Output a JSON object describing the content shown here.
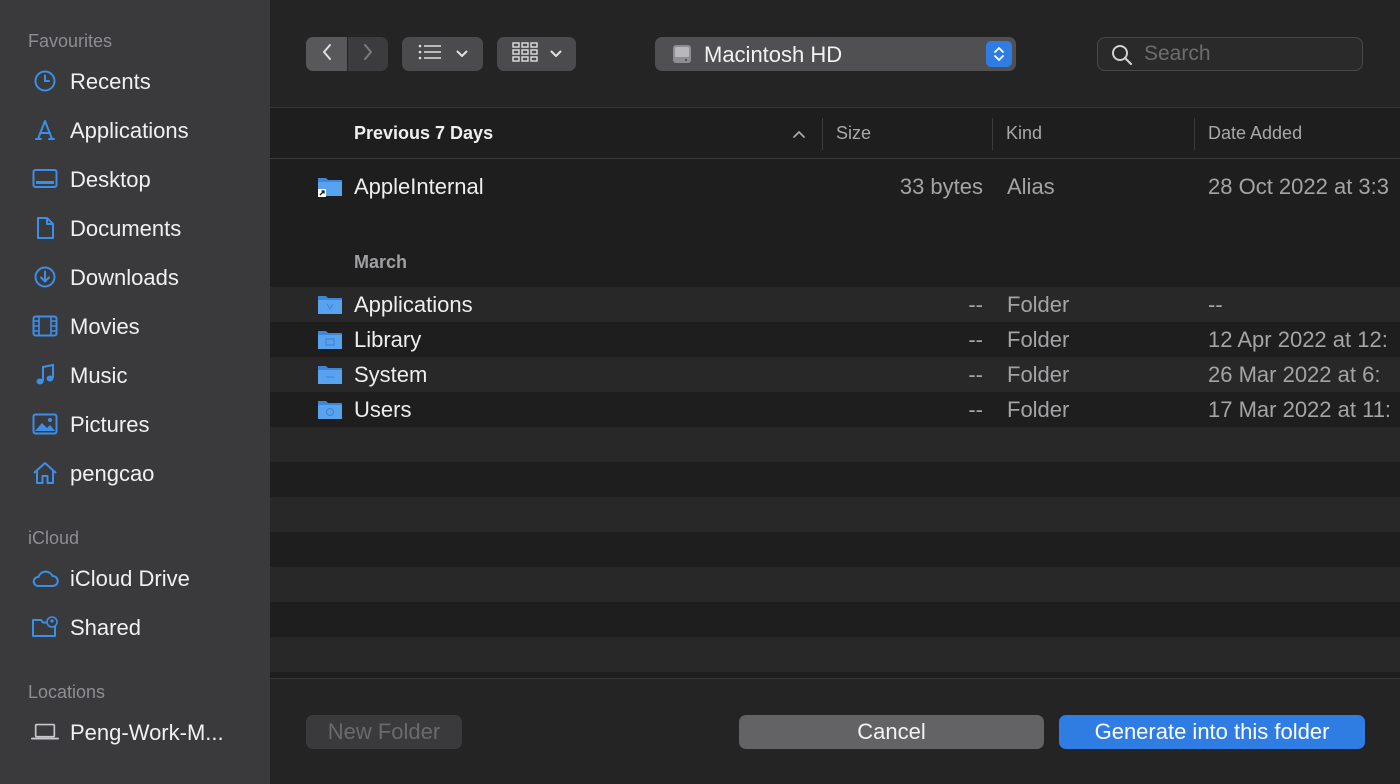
{
  "sidebar": {
    "favourites_header": "Favourites",
    "favourites": [
      {
        "label": "Recents",
        "icon": "clock-icon"
      },
      {
        "label": "Applications",
        "icon": "applications-icon"
      },
      {
        "label": "Desktop",
        "icon": "desktop-icon"
      },
      {
        "label": "Documents",
        "icon": "document-icon"
      },
      {
        "label": "Downloads",
        "icon": "download-icon"
      },
      {
        "label": "Movies",
        "icon": "film-icon"
      },
      {
        "label": "Music",
        "icon": "music-note-icon"
      },
      {
        "label": "Pictures",
        "icon": "photo-icon"
      },
      {
        "label": "pengcao",
        "icon": "home-icon"
      }
    ],
    "icloud_header": "iCloud",
    "icloud": [
      {
        "label": "iCloud Drive",
        "icon": "cloud-icon"
      },
      {
        "label": "Shared",
        "icon": "shared-folder-icon"
      }
    ],
    "locations_header": "Locations",
    "locations": [
      {
        "label": "Peng-Work-M...",
        "icon": "laptop-icon"
      }
    ]
  },
  "toolbar": {
    "location": "Macintosh HD",
    "search_placeholder": "Search"
  },
  "columns": {
    "name": "Previous 7 Days",
    "size": "Size",
    "kind": "Kind",
    "date": "Date Added"
  },
  "groups": [
    {
      "label": "",
      "rows": [
        {
          "name": "AppleInternal",
          "size": "33 bytes",
          "kind": "Alias",
          "date": "28 Oct 2022 at 3:3"
        }
      ]
    },
    {
      "label": "March",
      "rows": [
        {
          "name": "Applications",
          "size": "--",
          "kind": "Folder",
          "date": "--"
        },
        {
          "name": "Library",
          "size": "--",
          "kind": "Folder",
          "date": "12 Apr 2022 at 12:"
        },
        {
          "name": "System",
          "size": "--",
          "kind": "Folder",
          "date": "26 Mar 2022 at 6:"
        },
        {
          "name": "Users",
          "size": "--",
          "kind": "Folder",
          "date": "17 Mar 2022 at 11:"
        }
      ]
    }
  ],
  "buttons": {
    "new_folder": "New Folder",
    "cancel": "Cancel",
    "generate": "Generate into this folder"
  },
  "colors": {
    "accent": "#2f7de3",
    "sidebar_bg": "#3a3a3c",
    "window_bg": "#1e1e1e"
  }
}
